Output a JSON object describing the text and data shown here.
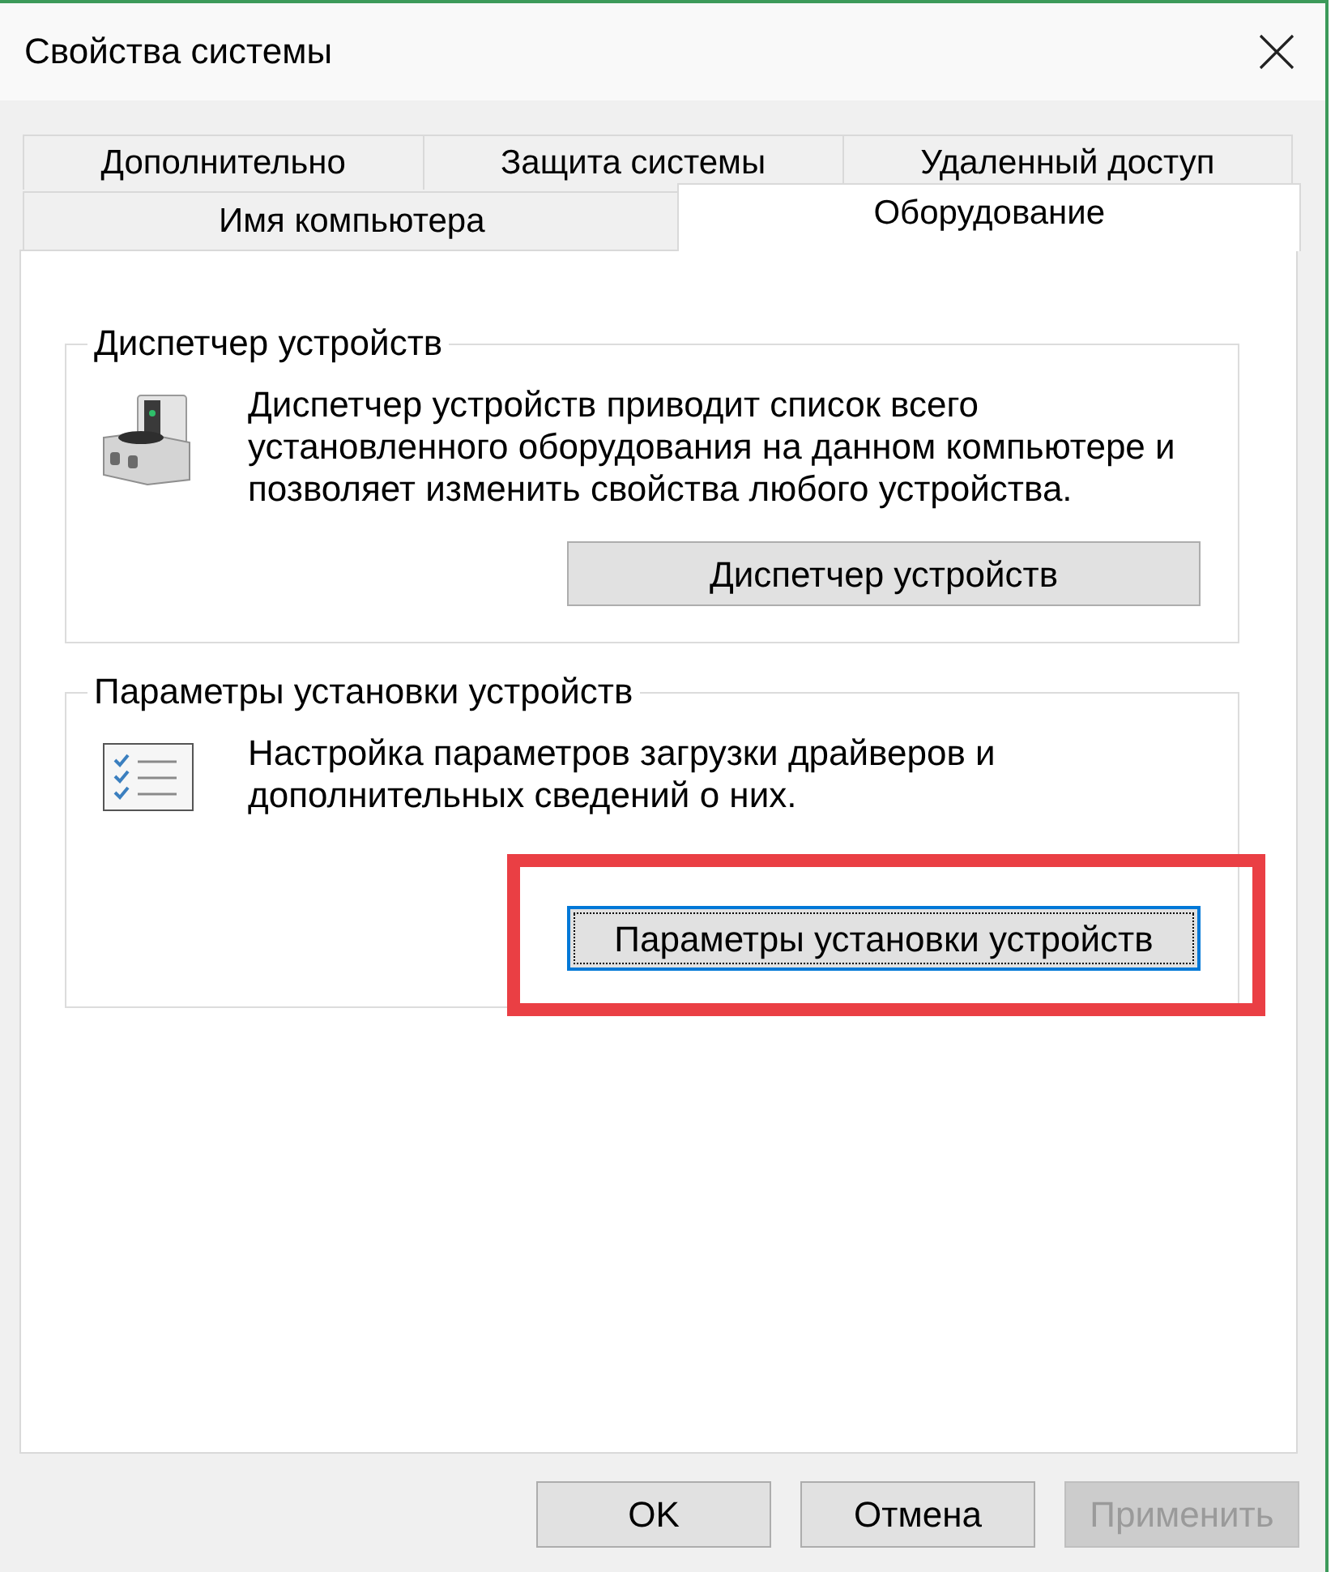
{
  "window": {
    "title": "Свойства системы"
  },
  "tab_rows": [
    [
      {
        "label": "Дополнительно",
        "selected": false
      },
      {
        "label": "Защита системы",
        "selected": false
      },
      {
        "label": "Удаленный доступ",
        "selected": false
      }
    ],
    [
      {
        "label": "Имя компьютера",
        "selected": false
      },
      {
        "label": "Оборудование",
        "selected": true
      }
    ]
  ],
  "groups": [
    {
      "kind": "device_manager",
      "title": "Диспетчер устройств",
      "description": "Диспетчер устройств приводит список всего\nустановленного оборудования на данном компьютере и\nпозволяет изменить свойства любого устройства.",
      "button": {
        "label": "Диспетчер устройств",
        "focused": false,
        "highlighted": false
      }
    },
    {
      "kind": "installation_settings",
      "title": "Параметры установки устройств",
      "description": "Настройка параметров загрузки драйверов и\nдополнительных сведений о них.",
      "button": {
        "label": "Параметры установки устройств",
        "focused": true,
        "highlighted": true
      }
    }
  ],
  "buttons": [
    {
      "label": "OK",
      "disabled": false
    },
    {
      "label": "Отмена",
      "disabled": false
    },
    {
      "label": "Применить",
      "disabled": true
    }
  ]
}
